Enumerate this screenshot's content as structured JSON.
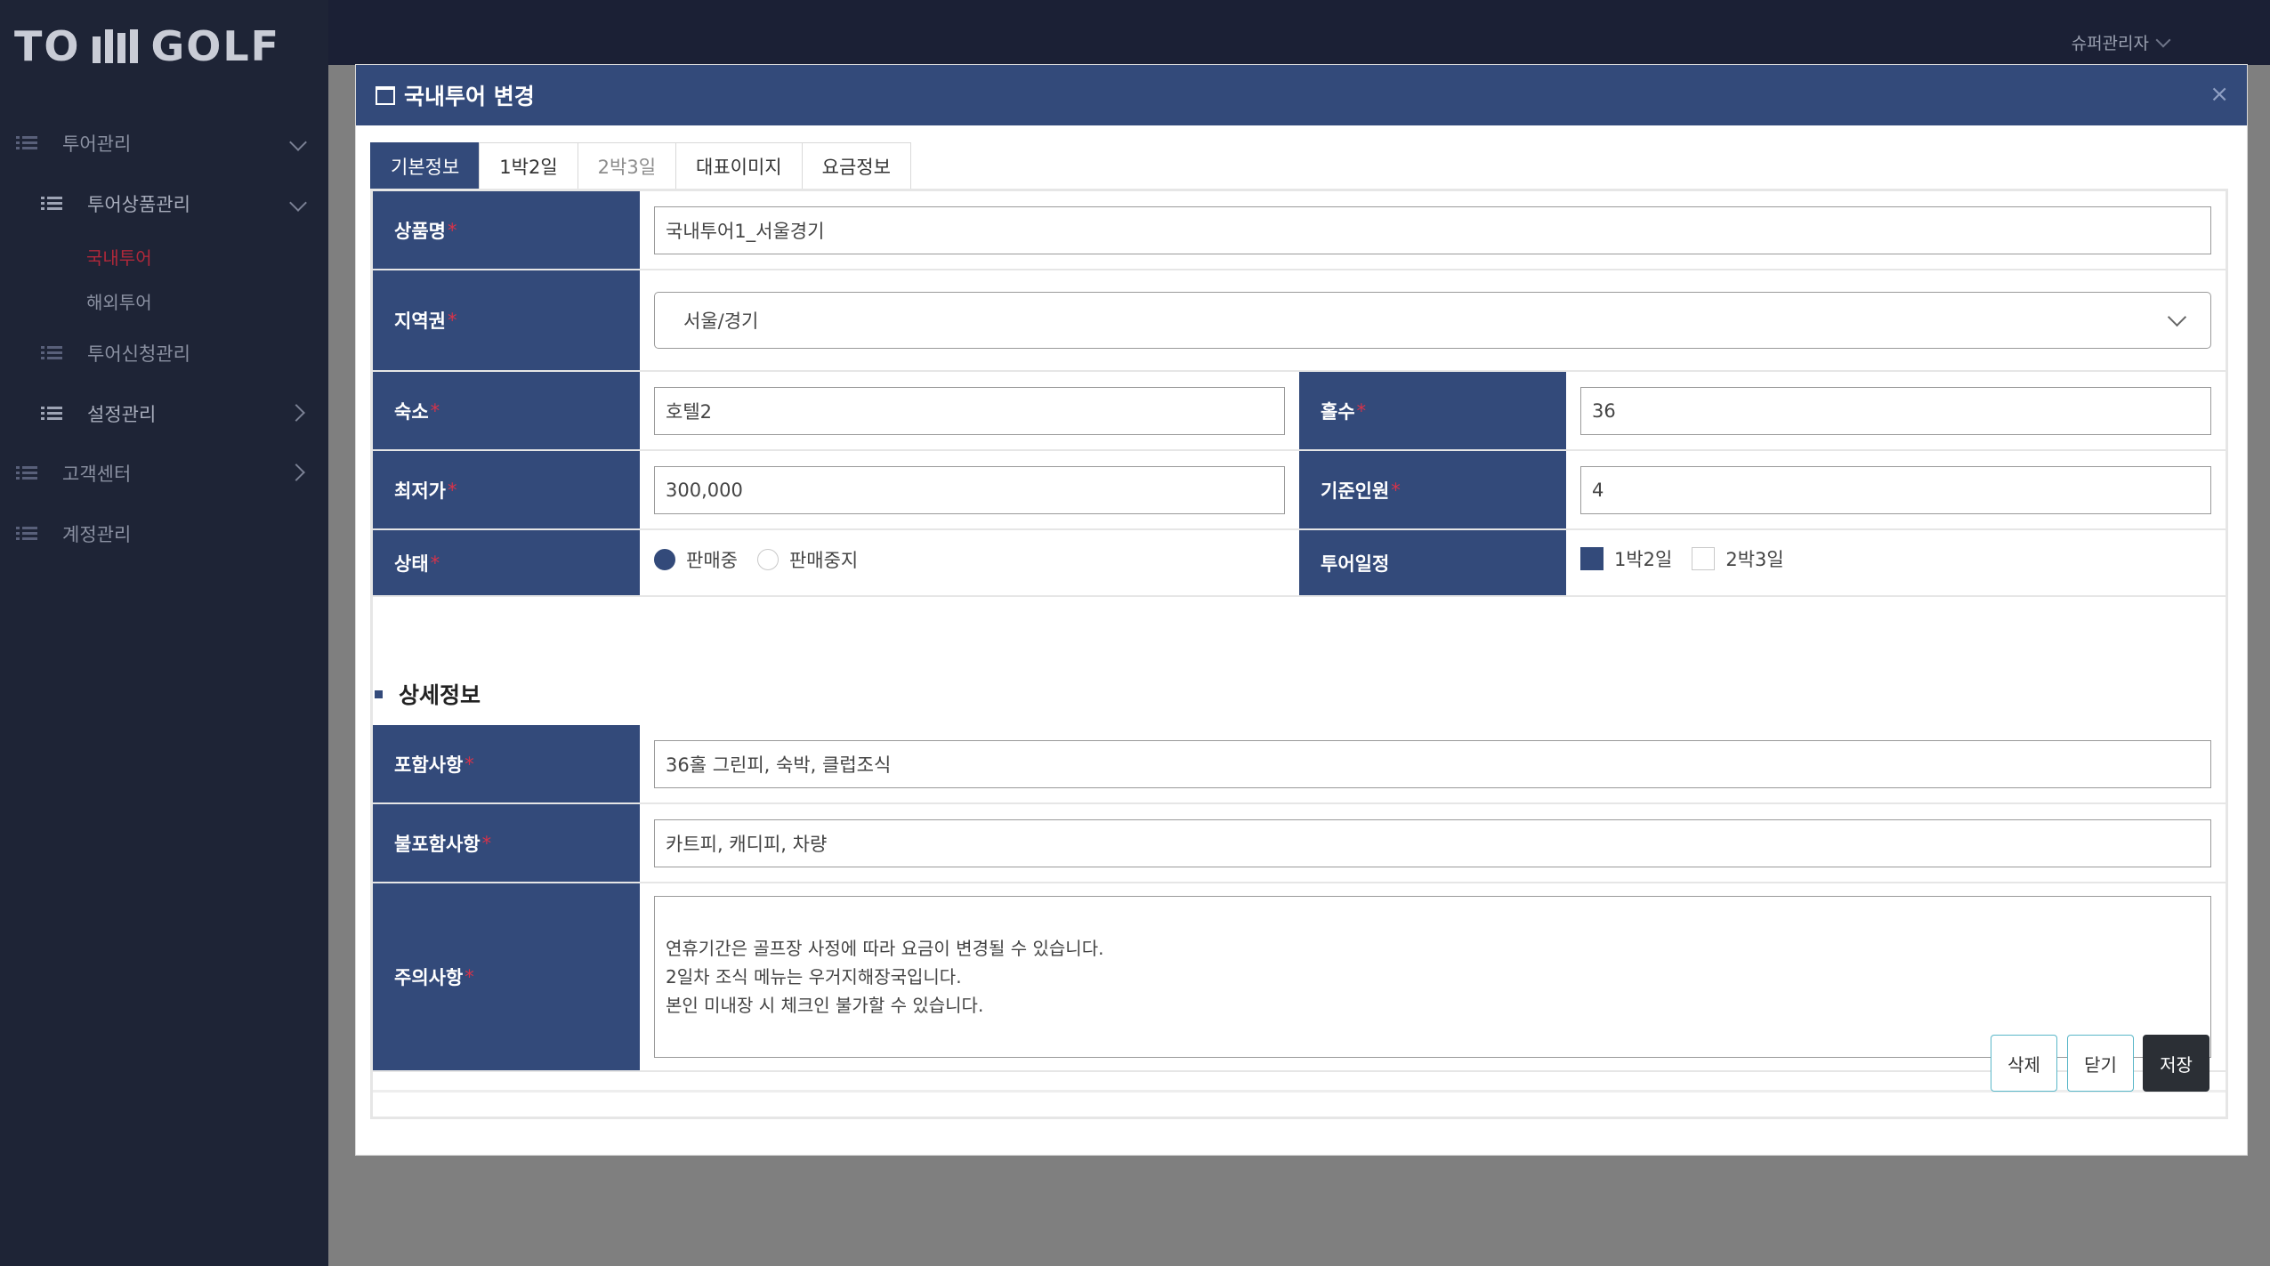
{
  "app": {
    "logo_left": "TO",
    "logo_right": "GOLF",
    "user_name": "슈퍼관리자"
  },
  "sidebar": {
    "items": [
      {
        "label": "투어관리"
      },
      {
        "label": "투어상품관리"
      },
      {
        "label": "국내투어"
      },
      {
        "label": "해외투어"
      },
      {
        "label": "투어신청관리"
      },
      {
        "label": "설정관리"
      },
      {
        "label": "고객센터"
      },
      {
        "label": "계정관리"
      }
    ]
  },
  "modal": {
    "title": "국내투어 변경",
    "close_glyph": "×",
    "tabs": [
      {
        "label": "기본정보"
      },
      {
        "label": "1박2일"
      },
      {
        "label": "2박3일"
      },
      {
        "label": "대표이미지"
      },
      {
        "label": "요금정보"
      }
    ],
    "fields": {
      "product_name": {
        "label": "상품명",
        "value": "국내투어1_서울경기"
      },
      "region": {
        "label": "지역권",
        "value": "서울/경기"
      },
      "lodging": {
        "label": "숙소",
        "value": "호텔2"
      },
      "holes": {
        "label": "홀수",
        "value": "36"
      },
      "min_price": {
        "label": "최저가",
        "value": "300,000"
      },
      "base_people": {
        "label": "기준인원",
        "value": "4"
      },
      "status": {
        "label": "상태",
        "options": [
          "판매중",
          "판매중지"
        ],
        "selected": "판매중"
      },
      "schedule": {
        "label": "투어일정",
        "options": [
          "1박2일",
          "2박3일"
        ],
        "checked": [
          "1박2일"
        ]
      }
    },
    "detail_section_title": "상세정보",
    "detail_fields": {
      "included": {
        "label": "포함사항",
        "value": "36홀 그린피, 숙박, 클럽조식"
      },
      "excluded": {
        "label": "불포함사항",
        "value": "카트피, 캐디피, 차량"
      },
      "notes": {
        "label": "주의사항",
        "value": "연휴기간은 골프장 사정에 따라 요금이 변경될 수 있습니다.\n2일차 조식 메뉴는 우거지해장국입니다.\n본인 미내장 시 체크인 불가할 수 있습니다."
      }
    },
    "required_mark": "*",
    "buttons": {
      "delete": "삭제",
      "close": "닫기",
      "save": "저장"
    }
  },
  "colors": {
    "accent": "#334a7a",
    "sidebar_bg": "#1e2436",
    "required": "#d6334a",
    "active_menu": "#b0283a",
    "outline_button": "#5ab7c8"
  }
}
